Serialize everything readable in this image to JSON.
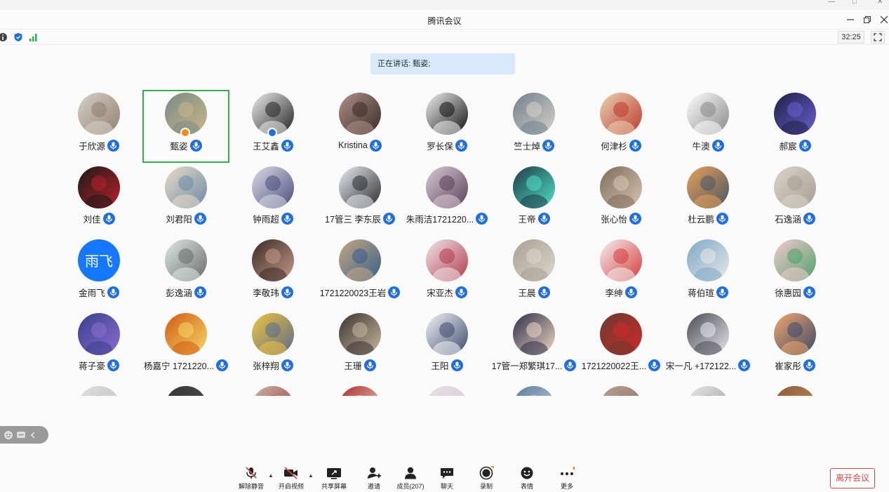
{
  "window": {
    "title": "腾讯会议"
  },
  "info_bar": {
    "timer": "32:25"
  },
  "speaker_banner": {
    "text": "正在讲话: 甄姿;"
  },
  "participants": [
    {
      "name": "于欣源",
      "avatar": "cat-photo",
      "colors": [
        "#d9d2c8",
        "#8f7f70"
      ]
    },
    {
      "name": "甄姿",
      "avatar": "watercolor-figures",
      "colors": [
        "#7a8c86",
        "#c9b48a"
      ],
      "speaking": true,
      "host": true
    },
    {
      "name": "王艾鑫",
      "avatar": "person-silhouette",
      "colors": [
        "#eeeeee",
        "#222222"
      ],
      "share": true
    },
    {
      "name": "Kristina",
      "avatar": "camera-photo",
      "colors": [
        "#b09088",
        "#3a2a28"
      ]
    },
    {
      "name": "罗长保",
      "avatar": "meme-face",
      "colors": [
        "#f2f2f2",
        "#111111"
      ]
    },
    {
      "name": "竺士焯",
      "avatar": "hamster-photo",
      "colors": [
        "#6f7f8f",
        "#d8d2c6"
      ]
    },
    {
      "name": "何津杉",
      "avatar": "cat-santa-hat",
      "colors": [
        "#e8d3b6",
        "#c0392b"
      ]
    },
    {
      "name": "牛澳",
      "avatar": "line-sketch",
      "colors": [
        "#ffffff",
        "#888888"
      ]
    },
    {
      "name": "郝宸",
      "avatar": "night-city",
      "colors": [
        "#1d1f44",
        "#6b5fd0"
      ]
    },
    {
      "name": "刘佳",
      "avatar": "red-eye",
      "colors": [
        "#1a1a1a",
        "#b8202a"
      ]
    },
    {
      "name": "刘君阳",
      "avatar": "tom-cartoon",
      "colors": [
        "#e9dcc8",
        "#6d8aa6"
      ]
    },
    {
      "name": "钟雨超",
      "avatar": "anime-girl",
      "colors": [
        "#dcdce8",
        "#4b4e7a"
      ]
    },
    {
      "name": "17管三 李东辰",
      "avatar": "portrait-woman",
      "colors": [
        "#e8eef2",
        "#2b2b2b"
      ]
    },
    {
      "name": "朱雨洁1721220...",
      "avatar": "anime-boy",
      "colors": [
        "#d8cbd6",
        "#5b3f58"
      ]
    },
    {
      "name": "王帝",
      "avatar": "anime-green",
      "colors": [
        "#1f3a47",
        "#4fe0c8"
      ]
    },
    {
      "name": "张心怡",
      "avatar": "room-photo",
      "colors": [
        "#7d6a5c",
        "#d8c7b0"
      ]
    },
    {
      "name": "杜云鹏",
      "avatar": "sunset-landscape",
      "colors": [
        "#e8a15a",
        "#4a5664"
      ]
    },
    {
      "name": "石逸涵",
      "avatar": "white-cat",
      "colors": [
        "#d9d4cc",
        "#a89f92"
      ]
    },
    {
      "name": "金雨飞",
      "avatar": "text-badge",
      "colors": [
        "#1677ff",
        "#ffffff"
      ],
      "label": "雨飞"
    },
    {
      "name": "彭逸涵",
      "avatar": "bike-sketch",
      "colors": [
        "#dfe9e6",
        "#6b6b6b"
      ]
    },
    {
      "name": "李敬玮",
      "avatar": "cat-paw",
      "colors": [
        "#3a2a25",
        "#c79a8a"
      ]
    },
    {
      "name": "1721220023王岩",
      "avatar": "child-photo",
      "colors": [
        "#c7a782",
        "#355f8a"
      ]
    },
    {
      "name": "宋亚杰",
      "avatar": "anime-sketch",
      "colors": [
        "#efe6e9",
        "#b43b4b"
      ]
    },
    {
      "name": "王晨",
      "avatar": "cat-meme",
      "colors": [
        "#a8a092",
        "#dcd6cc"
      ]
    },
    {
      "name": "李绅",
      "avatar": "crayon-shin",
      "colors": [
        "#f3f3f3",
        "#d63a3a"
      ]
    },
    {
      "name": "蒋伯瑄",
      "avatar": "car-photo",
      "colors": [
        "#7ea7c6",
        "#e8e8e8"
      ]
    },
    {
      "name": "徐惠园",
      "avatar": "cartoon-character",
      "colors": [
        "#f6c8cf",
        "#4fa36b"
      ]
    },
    {
      "name": "蒋子豪",
      "avatar": "anime-blue",
      "colors": [
        "#3a3e8c",
        "#8a6fd0"
      ]
    },
    {
      "name": "杨嘉宁 1721220...",
      "avatar": "fire-cat",
      "colors": [
        "#d25a10",
        "#f6d86a"
      ]
    },
    {
      "name": "张梓翔",
      "avatar": "psyduck",
      "colors": [
        "#f0c540",
        "#5a6b8a"
      ]
    },
    {
      "name": "王珊",
      "avatar": "anime-hat",
      "colors": [
        "#3a3330",
        "#c8b8a0"
      ]
    },
    {
      "name": "王阳",
      "avatar": "anime-couple",
      "colors": [
        "#f4f4f8",
        "#3c4a6a"
      ]
    },
    {
      "name": "17管一郑繁琪17...",
      "avatar": "anime-chibi",
      "colors": [
        "#2b2f4a",
        "#f1d7c4"
      ]
    },
    {
      "name": "1721220022王...",
      "avatar": "santa-girl",
      "colors": [
        "#6a3a30",
        "#d02a2a"
      ]
    },
    {
      "name": "宋一凡 +172122...",
      "avatar": "dark-character",
      "colors": [
        "#4a4a52",
        "#e8e8ee"
      ]
    },
    {
      "name": "崔家彤",
      "avatar": "sunset-person",
      "colors": [
        "#f2a66a",
        "#3a4a6a"
      ]
    },
    {
      "name": "",
      "avatar": "partial",
      "colors": [
        "#e0e0e0",
        "#bbbbbb"
      ]
    },
    {
      "name": "",
      "avatar": "partial",
      "colors": [
        "#333333",
        "#555555"
      ]
    },
    {
      "name": "",
      "avatar": "partial",
      "colors": [
        "#c8b8a8",
        "#a03030"
      ]
    },
    {
      "name": "",
      "avatar": "partial",
      "colors": [
        "#b02a2a",
        "#e8e0d8"
      ]
    },
    {
      "name": "",
      "avatar": "partial",
      "colors": [
        "#e8e0e8",
        "#cccccc"
      ]
    },
    {
      "name": "",
      "avatar": "partial",
      "colors": [
        "#5a7a9a",
        "#c8d8e8"
      ]
    },
    {
      "name": "",
      "avatar": "partial",
      "colors": [
        "#b8a090",
        "#8a7060"
      ]
    },
    {
      "name": "",
      "avatar": "partial",
      "colors": [
        "#e8e8e8",
        "#999999"
      ]
    },
    {
      "name": "",
      "avatar": "partial",
      "colors": [
        "#8a5a3a",
        "#c89060"
      ]
    }
  ],
  "toolbar": {
    "unmute": "解除静音",
    "start_video": "开启视频",
    "share_screen": "共享屏幕",
    "invite": "邀请",
    "members": "成员(207)",
    "chat": "聊天",
    "record": "录制",
    "reactions": "表情",
    "more": "更多",
    "leave": "离开会议"
  },
  "colors": {
    "accent": "#1f6fe0",
    "speaking_border": "#2db34a",
    "leave": "#e04545",
    "banner": "#d9e8fb"
  }
}
